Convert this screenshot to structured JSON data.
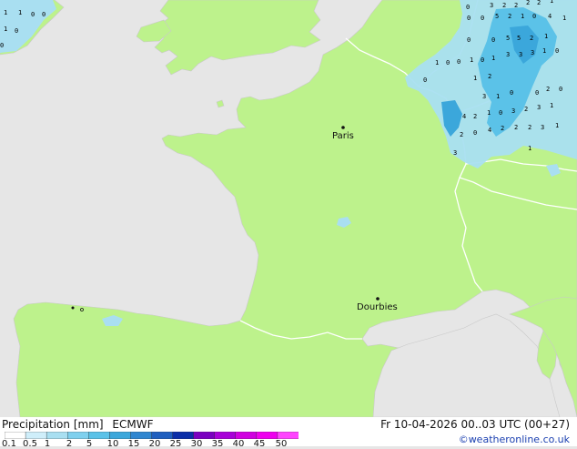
{
  "map": {
    "cities": [
      {
        "name": "Paris"
      },
      {
        "name": "Dourbies"
      }
    ],
    "precip_values_ne": [
      "0",
      "3",
      "2",
      "2",
      "2",
      "2",
      "1",
      "0",
      "0",
      "5",
      "2",
      "1",
      "0",
      "4",
      "1",
      "0",
      "0",
      "5",
      "5",
      "2",
      "1",
      "1",
      "0",
      "0",
      "1",
      "0",
      "1",
      "3",
      "3",
      "3",
      "1",
      "0",
      "0",
      "1",
      "2",
      "0",
      "3",
      "1",
      "0",
      "2",
      "0",
      "4",
      "2",
      "1",
      "0",
      "3",
      "2",
      "3",
      "1",
      "2",
      "0",
      "4",
      "2",
      "2",
      "2",
      "3",
      "1",
      "3",
      "1"
    ],
    "precip_values_nw": [
      "1",
      "1",
      "0",
      "0",
      "1",
      "0",
      "0"
    ],
    "colors": {
      "land": "#bdf28c",
      "sea": "#e6e6e6",
      "border": "#ffffff",
      "precip_light": "#a9dff1",
      "precip_mid": "#5bc2e8",
      "precip_strong": "#3ba7db"
    }
  },
  "footer": {
    "title": "Precipitation [mm]",
    "model": "ECMWF",
    "valid_time": "Fr 10-04-2026 00..03 UTC (00+27)",
    "credit": "©weatheronline.co.uk",
    "legend_ticks": [
      "0.1",
      "0.5",
      "1",
      "2",
      "5",
      "10",
      "15",
      "20",
      "25",
      "30",
      "35",
      "40",
      "45",
      "50"
    ],
    "legend_colors": [
      "#ffffff",
      "#cfeefa",
      "#a9dff1",
      "#7fd0ee",
      "#5bc2e8",
      "#3ba7db",
      "#2f86d0",
      "#1f5fbf",
      "#0b2ea8",
      "#7a00c0",
      "#a800d8",
      "#d000e0",
      "#ee00ee",
      "#ff44ff"
    ]
  }
}
